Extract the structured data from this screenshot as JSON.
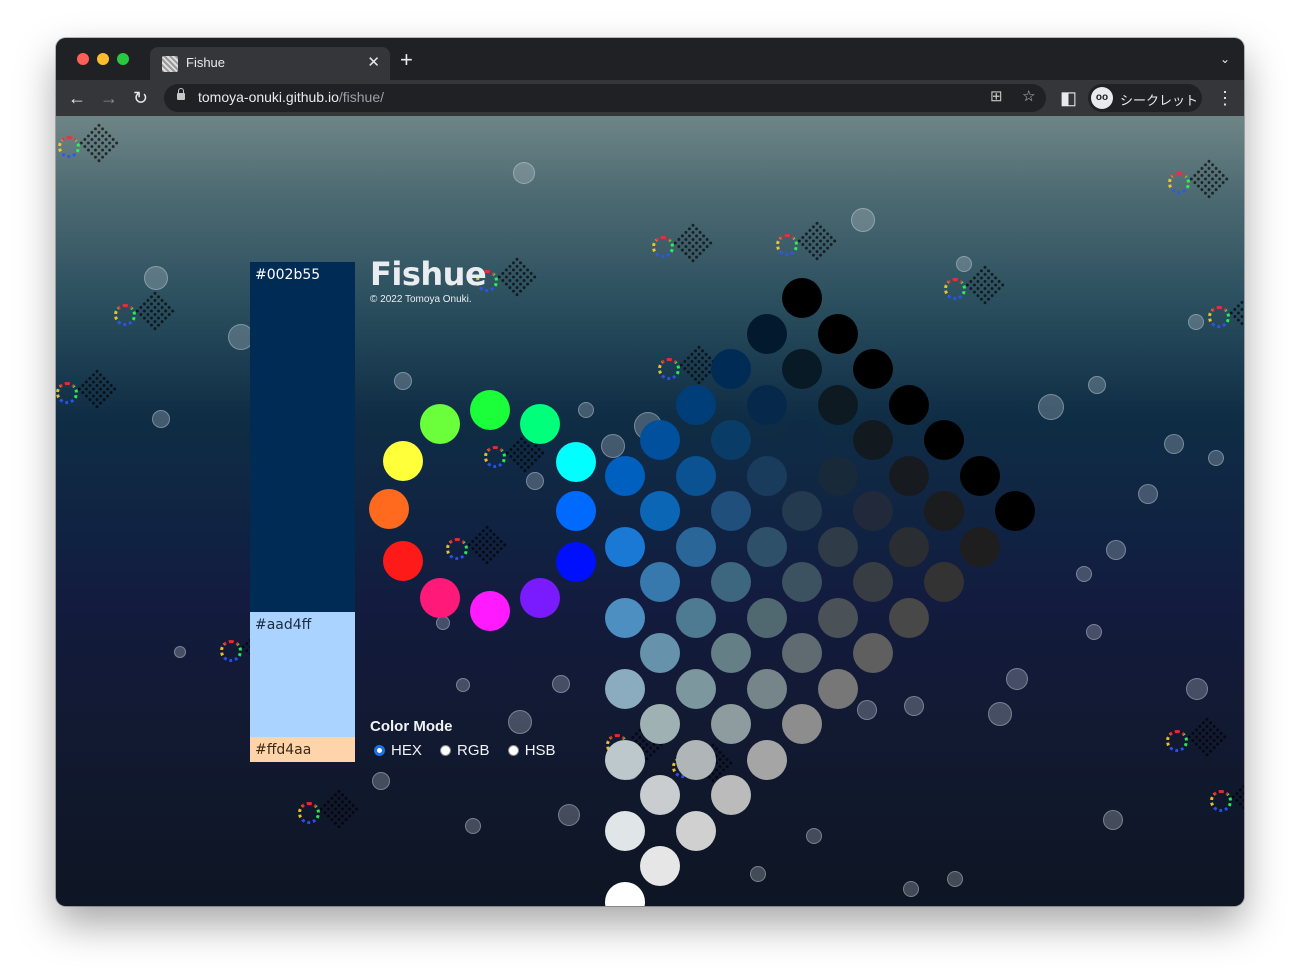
{
  "browser": {
    "tab_title": "Fishue",
    "tab_close": "✕",
    "new_tab": "+",
    "tab_menu": "⌄",
    "url_host": "tomoya-onuki.github.io",
    "url_path": "/fishue/",
    "incognito_label": "シークレット",
    "incognito_icon": "incognito-icon",
    "nav_icons": [
      "back-icon",
      "forward-icon",
      "reload-icon"
    ]
  },
  "app": {
    "title": "Fishue",
    "copyright": "© 2022 Tomoya Onuki.",
    "color_mode_title": "Color Mode",
    "color_modes": [
      {
        "label": "HEX",
        "checked": true
      },
      {
        "label": "RGB",
        "checked": false
      },
      {
        "label": "HSB",
        "checked": false
      }
    ],
    "palette": [
      {
        "hex": "#002b55",
        "share": 0.7,
        "text_color": "#ffffff"
      },
      {
        "hex": "#aad4ff",
        "share": 0.25,
        "text_color": "#1c2c40"
      },
      {
        "hex": "#ffd4aa",
        "share": 0.05,
        "text_color": "#3a2a18"
      }
    ],
    "hue_ring": [
      "#ff9a1a",
      "#ff6a1f",
      "#ff1a1a",
      "#ff1a7a",
      "#ff1aff",
      "#7a1aff",
      "#0010ff",
      "#006aff",
      "#00ffff",
      "#00ff7a",
      "#1aff3a",
      "#6aff3a",
      "#ffff3a"
    ],
    "shade_grid_rows": [
      [
        "#000000",
        "#000000",
        "#000000",
        "#000000",
        "#000000",
        "#000000",
        "#000000"
      ],
      [
        "#031a2e",
        "#081a26",
        "#0d1a22",
        "#121a20",
        "#171b1f",
        "#1b1c1d",
        "#1e1e1e"
      ],
      [
        "#002b55",
        "#06294b",
        "#0e2a44",
        "#18293a",
        "#22293a",
        "#2a2d31",
        "#333333"
      ],
      [
        "#003e7a",
        "#0a3c68",
        "#1a3c5c",
        "#243a4f",
        "#2f3b46",
        "#373d42",
        "#484848"
      ],
      [
        "#00509e",
        "#0a5291",
        "#1f4f7a",
        "#2e5068",
        "#3d5260",
        "#4a5257",
        "#5f5f5f"
      ],
      [
        "#0060c0",
        "#0b66b5",
        "#2a6698",
        "#3d667f",
        "#506970",
        "#5f6b70",
        "#777777"
      ],
      [
        "#0070e0",
        "#1a79d4",
        "#3779ad",
        "#4e7a92",
        "#647f86",
        "#75858a",
        "#8d8d8d"
      ],
      [
        "#0085ff",
        "#2b8ee8",
        "#4e8fc2",
        "#6693ab",
        "#7c979d",
        "#8e9c9f",
        "#a5a5a5"
      ],
      [
        "#339cff",
        "#55a6f2",
        "#72a9d3",
        "#8bacbe",
        "#a0b1b4",
        "#b0b6b8",
        "#bbbbbb"
      ],
      [
        "#66b5ff",
        "#85bff5",
        "#9ac3e2",
        "#abc5d2",
        "#bcc8cc",
        "#c9cdcf",
        "#d0d0d0"
      ],
      [
        "#99ceff",
        "#add6fa",
        "#bfdcef",
        "#cadfe8",
        "#d7e3e6",
        "#e0e5e7",
        "#e6e6e6"
      ],
      [
        "#cce6ff",
        "#d4ebff",
        "#dcefff",
        "#e5f3ff",
        "#edf6ff",
        "#f5faff",
        "#ffffff"
      ]
    ]
  }
}
